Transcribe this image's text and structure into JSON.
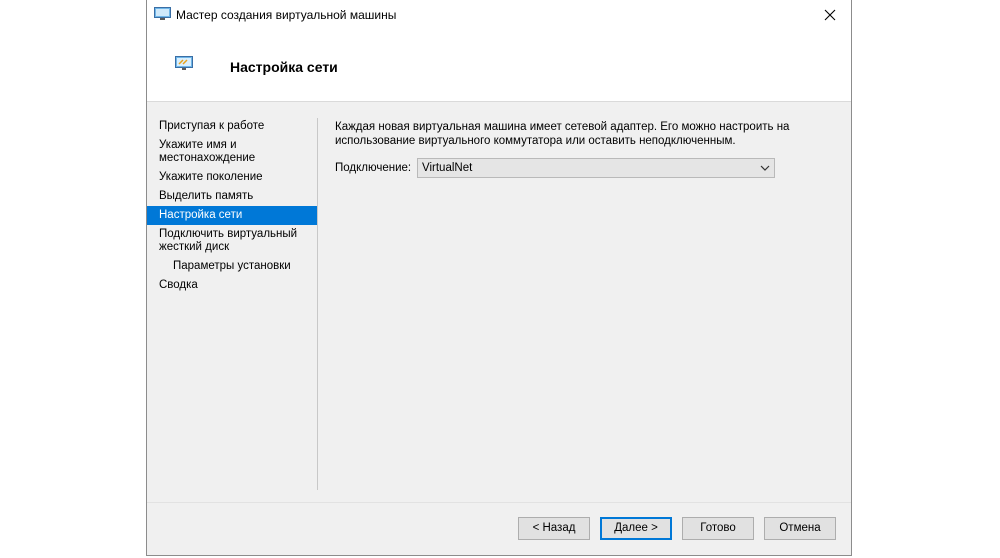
{
  "window": {
    "title": "Мастер создания виртуальной машины",
    "icon": "monitor-icon"
  },
  "header": {
    "title": "Настройка сети",
    "icon": "network-adapter-icon"
  },
  "nav": {
    "items": [
      {
        "label": "Приступая к работе"
      },
      {
        "label": "Укажите имя и местонахождение"
      },
      {
        "label": "Укажите поколение"
      },
      {
        "label": "Выделить память"
      },
      {
        "label": "Настройка сети",
        "selected": true
      },
      {
        "label": "Подключить виртуальный жесткий диск"
      },
      {
        "label": "Параметры установки",
        "sub": true
      },
      {
        "label": "Сводка"
      }
    ]
  },
  "content": {
    "description": "Каждая новая виртуальная машина имеет сетевой адаптер. Его можно настроить на использование виртуального коммутатора или оставить неподключенным.",
    "connection_label": "Подключение:",
    "connection_value": "VirtualNet"
  },
  "buttons": {
    "back": "< Назад",
    "next": "Далее >",
    "done": "Готово",
    "cancel": "Отмена"
  },
  "colors": {
    "accent": "#0078d7",
    "dialog_bg": "#f0f0f0"
  }
}
